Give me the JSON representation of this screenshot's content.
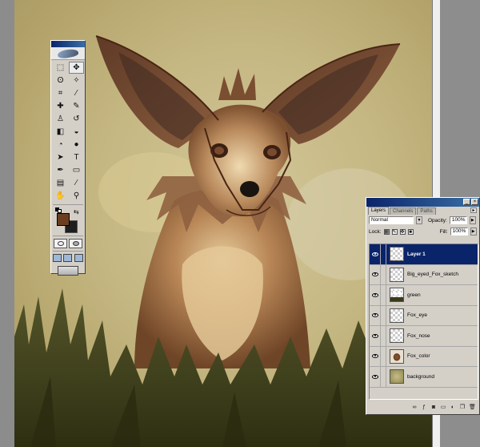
{
  "toolbox": {
    "tools": [
      {
        "name": "marquee-tool-icon",
        "glyph": "⬚"
      },
      {
        "name": "move-tool-icon",
        "glyph": "✥",
        "active": true
      },
      {
        "name": "lasso-tool-icon",
        "glyph": "ʘ"
      },
      {
        "name": "magic-wand-tool-icon",
        "glyph": "✧"
      },
      {
        "name": "crop-tool-icon",
        "glyph": "⌗"
      },
      {
        "name": "slice-tool-icon",
        "glyph": "⁄"
      },
      {
        "name": "healing-brush-tool-icon",
        "glyph": "✚"
      },
      {
        "name": "brush-tool-icon",
        "glyph": "✎"
      },
      {
        "name": "clone-stamp-tool-icon",
        "glyph": "♙"
      },
      {
        "name": "history-brush-tool-icon",
        "glyph": "↺"
      },
      {
        "name": "eraser-tool-icon",
        "glyph": "◧"
      },
      {
        "name": "paint-bucket-tool-icon",
        "glyph": "◒"
      },
      {
        "name": "blur-tool-icon",
        "glyph": "◔"
      },
      {
        "name": "dodge-tool-icon",
        "glyph": "●"
      },
      {
        "name": "path-selection-tool-icon",
        "glyph": "➤"
      },
      {
        "name": "type-tool-icon",
        "glyph": "T"
      },
      {
        "name": "pen-tool-icon",
        "glyph": "✒"
      },
      {
        "name": "shape-tool-icon",
        "glyph": "▭"
      },
      {
        "name": "notes-tool-icon",
        "glyph": "▤"
      },
      {
        "name": "eyedropper-tool-icon",
        "glyph": "⁄"
      },
      {
        "name": "hand-tool-icon",
        "glyph": "✋"
      },
      {
        "name": "zoom-tool-icon",
        "glyph": "⚲"
      }
    ],
    "colors": {
      "foreground": "#6b3e22",
      "background": "#1e1e1e"
    }
  },
  "layers_panel": {
    "tabs": [
      "Layers",
      "Channels",
      "Paths"
    ],
    "active_tab": "Layers",
    "blend_mode": "Normal",
    "opacity_label": "Opacity:",
    "opacity_value": "100%",
    "lock_label": "Lock:",
    "fill_label": "Fill:",
    "fill_value": "100%",
    "layers": [
      {
        "name": "Layer 1",
        "selected": true,
        "thumb": "transparent"
      },
      {
        "name": "Big_eyed_Fox_sketch",
        "selected": false,
        "thumb": "transparent"
      },
      {
        "name": "green",
        "selected": false,
        "thumb": "green"
      },
      {
        "name": "Fox_eye",
        "selected": false,
        "thumb": "transparent"
      },
      {
        "name": "Fox_nose",
        "selected": false,
        "thumb": "transparent"
      },
      {
        "name": "Fox_color",
        "selected": false,
        "thumb": "fox"
      },
      {
        "name": "background",
        "selected": false,
        "thumb": "bg"
      }
    ],
    "footer_icons": [
      "link-icon",
      "layer-style-icon",
      "mask-icon",
      "new-set-icon",
      "adjustment-layer-icon",
      "new-layer-icon",
      "trash-icon"
    ]
  },
  "colors": {
    "accent": "#0a246a",
    "canvas": "#c5b782",
    "fox_fur": "#8a5a36",
    "grass": "#3c3d18"
  }
}
